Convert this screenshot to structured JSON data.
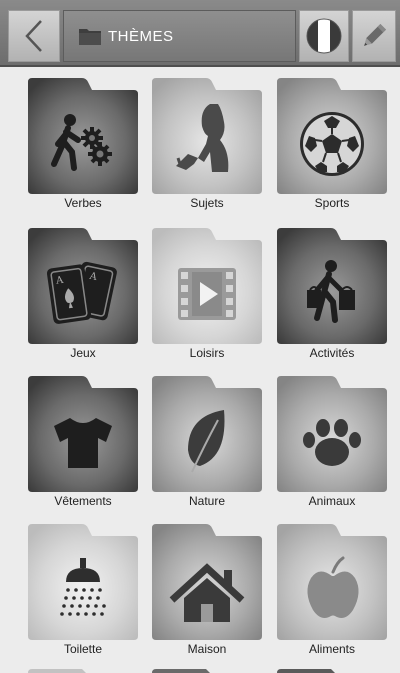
{
  "header": {
    "title": "THÈMES",
    "back_icon": "chevron-left-icon",
    "title_icon": "folder-icon",
    "language_icon": "french-flag-icon",
    "edit_icon": "pencil-icon"
  },
  "themes": [
    {
      "label": "Verbes",
      "icon": "walking-person-gears-icon",
      "shade": "dark"
    },
    {
      "label": "Sujets",
      "icon": "person-pointing-icon",
      "shade": "light"
    },
    {
      "label": "Sports",
      "icon": "soccer-ball-icon",
      "shade": "medium"
    },
    {
      "label": "Jeux",
      "icon": "playing-cards-icon",
      "shade": "dark"
    },
    {
      "label": "Loisirs",
      "icon": "video-film-icon",
      "shade": "pale"
    },
    {
      "label": "Activités",
      "icon": "shopping-person-icon",
      "shade": "dark"
    },
    {
      "label": "Vêtements",
      "icon": "tshirt-icon",
      "shade": "dark"
    },
    {
      "label": "Nature",
      "icon": "leaf-icon",
      "shade": "medium"
    },
    {
      "label": "Animaux",
      "icon": "paw-print-icon",
      "shade": "medium"
    },
    {
      "label": "Toilette",
      "icon": "shower-icon",
      "shade": "pale"
    },
    {
      "label": "Maison",
      "icon": "house-icon",
      "shade": "medium"
    },
    {
      "label": "Aliments",
      "icon": "apple-icon",
      "shade": "light"
    }
  ],
  "colors": {
    "topbar": "#7a7a7a",
    "background": "#ececec",
    "flag_blue": "#3a3a3a",
    "flag_white": "#ffffff",
    "flag_red": "#3a3a3a"
  }
}
